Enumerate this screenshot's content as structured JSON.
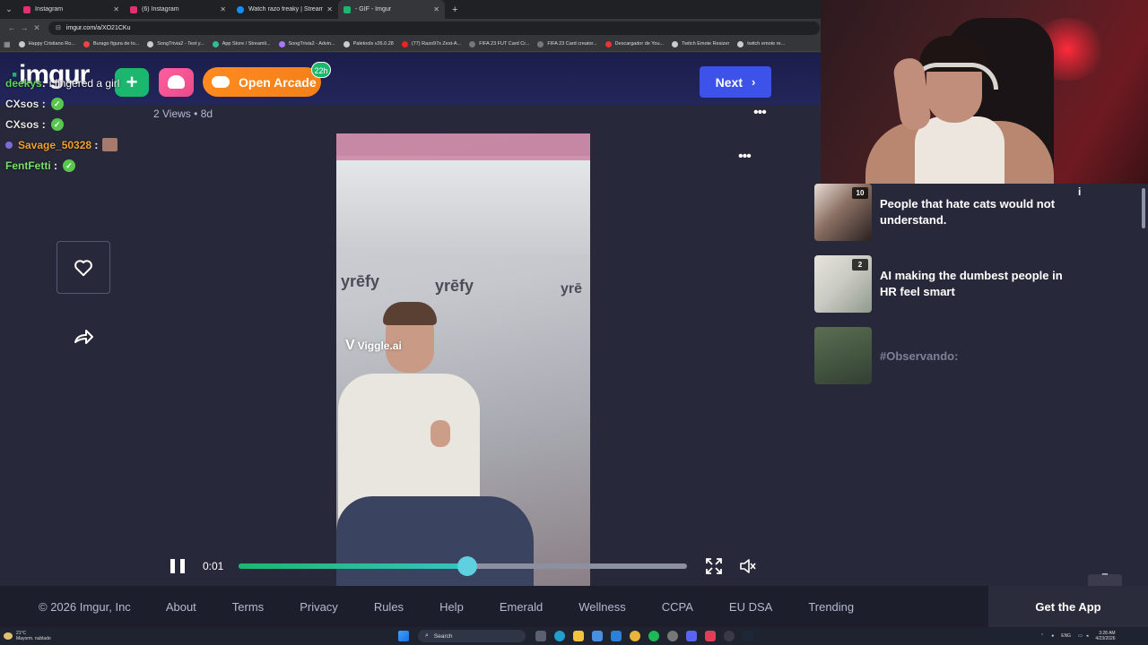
{
  "browser": {
    "tabs": [
      {
        "label": "Instagram",
        "color": "#e1306c"
      },
      {
        "label": "(6) Instagram",
        "color": "#e1306c"
      },
      {
        "label": "Watch razo freaky | Streamable",
        "color": "#0f90fa"
      },
      {
        "label": "- GIF - Imgur",
        "color": "#1bb76e"
      }
    ],
    "url": "imgur.com/a/XO21CKu",
    "bookmarks": [
      {
        "label": "Happy Cristiano Ro...",
        "color": "#c9c9c9"
      },
      {
        "label": "Burago figura de to...",
        "color": "#e44"
      },
      {
        "label": "SongTrivia2 - Test y...",
        "color": "#ccc"
      },
      {
        "label": "App Store / Streamli...",
        "color": "#3b9"
      },
      {
        "label": "SongTrivia2 - Advin...",
        "color": "#a7f"
      },
      {
        "label": "Paletools v26.0.28",
        "color": "#ccc"
      },
      {
        "label": "(77) Razo97s Zest-A...",
        "color": "#e22"
      },
      {
        "label": "FIFA 23 FUT Card Cr...",
        "color": "#777"
      },
      {
        "label": "FIFA 23 Card creator...",
        "color": "#777"
      },
      {
        "label": "Descargador de You...",
        "color": "#e33"
      },
      {
        "label": "Twitch Emote Resizer",
        "color": "#ccc"
      },
      {
        "label": "twitch emote re...",
        "color": "#ccc"
      }
    ]
  },
  "header": {
    "logo": "imgur",
    "upload_icon": "plus-icon",
    "arcade_label": "Open Arcade",
    "arcade_badge": "22h",
    "next_label": "Next"
  },
  "post": {
    "views": "2 Views",
    "age": "8d",
    "watermark": "Viggle.ai"
  },
  "chat": [
    {
      "user": "deekys",
      "message": "i fingered a girl",
      "color": "#5fd35a",
      "emote": "none"
    },
    {
      "user": "CXsos",
      "message": "",
      "color": "#e6e6e6",
      "emote": "check"
    },
    {
      "user": "CXsos",
      "message": "",
      "color": "#e6e6e6",
      "emote": "check"
    },
    {
      "user": "Savage_50328",
      "message": "",
      "color": "#f0a030",
      "emote": "image"
    },
    {
      "user": "FentFetti",
      "message": "",
      "color": "#7be06b",
      "emote": "check"
    }
  ],
  "player": {
    "time": "0:01",
    "progress": 0.51
  },
  "sidebar_posts": [
    {
      "title": "People that hate cats would not understand.",
      "count": "10",
      "thumb": "#8a6f63"
    },
    {
      "title": "AI making the dumbest people in HR feel smart",
      "count": "2",
      "thumb": "#c8c9c2"
    },
    {
      "title": "#Observando:",
      "count": "",
      "thumb": "#5c7a45"
    }
  ],
  "footer": {
    "copyright": "© 2026 Imgur, Inc",
    "links": [
      "About",
      "Terms",
      "Privacy",
      "Rules",
      "Help",
      "Emerald",
      "Wellness",
      "CCPA",
      "EU DSA",
      "Trending"
    ],
    "get_app": "Get the App"
  },
  "taskbar": {
    "weather_temp": "21°C",
    "weather_desc": "Mayorm. nublado",
    "search": "Search",
    "lang": "ENG",
    "time": "3:28 AM",
    "date": "4/23/2026"
  }
}
